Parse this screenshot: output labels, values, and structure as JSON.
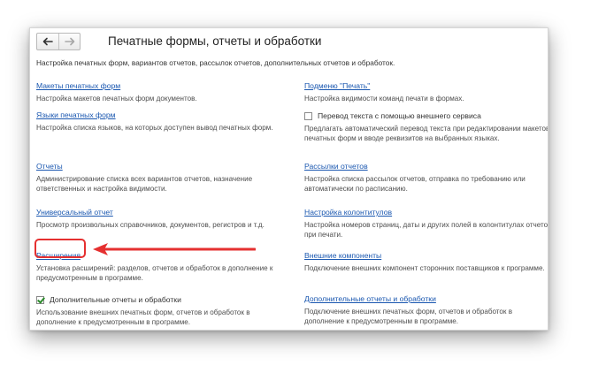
{
  "window": {
    "title": "Печатные формы, отчеты и обработки",
    "subtitle": "Настройка печатных форм, вариантов отчетов, рассылок отчетов, дополнительных отчетов и обработок."
  },
  "nav": {
    "back_icon": "arrow-left-icon",
    "forward_icon": "arrow-right-icon"
  },
  "left": {
    "items": [
      {
        "link": "Макеты печатных форм",
        "desc": "Настройка макетов печатных форм документов."
      },
      {
        "link": "Языки печатных форм",
        "desc": "Настройка списка языков, на которых доступен вывод печатных форм."
      },
      {
        "link": "Отчеты",
        "desc": "Администрирование списка всех вариантов отчетов, назначение ответственных и настройка видимости."
      },
      {
        "link": "Универсальный отчет",
        "desc": "Просмотр произвольных справочников, документов, регистров и т.д."
      },
      {
        "link": "Расширения",
        "desc": "Установка расширений: разделов, отчетов и обработок в дополнение к предусмотренным в программе."
      }
    ],
    "checkbox": {
      "label": "Дополнительные отчеты и обработки",
      "checked": true,
      "desc": "Использование внешних печатных форм, отчетов и обработок в дополнение к предусмотренным в программе."
    }
  },
  "right": {
    "items": [
      {
        "link": "Подменю \"Печать\"",
        "desc": "Настройка видимости команд печати в формах."
      },
      {
        "link": "Рассылки отчетов",
        "desc": "Настройка списка рассылок отчетов, отправка по требованию или автоматически по расписанию."
      },
      {
        "link": "Настройка колонтитулов",
        "desc": "Настройка номеров страниц, даты и других полей в колонтитулах отчетов при печати."
      },
      {
        "link": "Внешние компоненты",
        "desc": "Подключение внешних компонент сторонних поставщиков к программе."
      },
      {
        "link": "Дополнительные отчеты и обработки",
        "desc": "Подключение внешних печатных форм, отчетов и обработок в дополнение к предусмотренным в программе."
      }
    ],
    "checkbox": {
      "label": "Перевод текста с помощью внешнего сервиса",
      "checked": false,
      "desc": "Предлагать автоматический перевод текста при редактировании макетов печатных форм и вводе реквизитов на выбранных языках."
    }
  },
  "annotation": {
    "highlight_color": "#e53030",
    "target": "Расширения"
  },
  "colors": {
    "link": "#1a57b0",
    "text": "#333333",
    "desc": "#4d4d4d"
  }
}
